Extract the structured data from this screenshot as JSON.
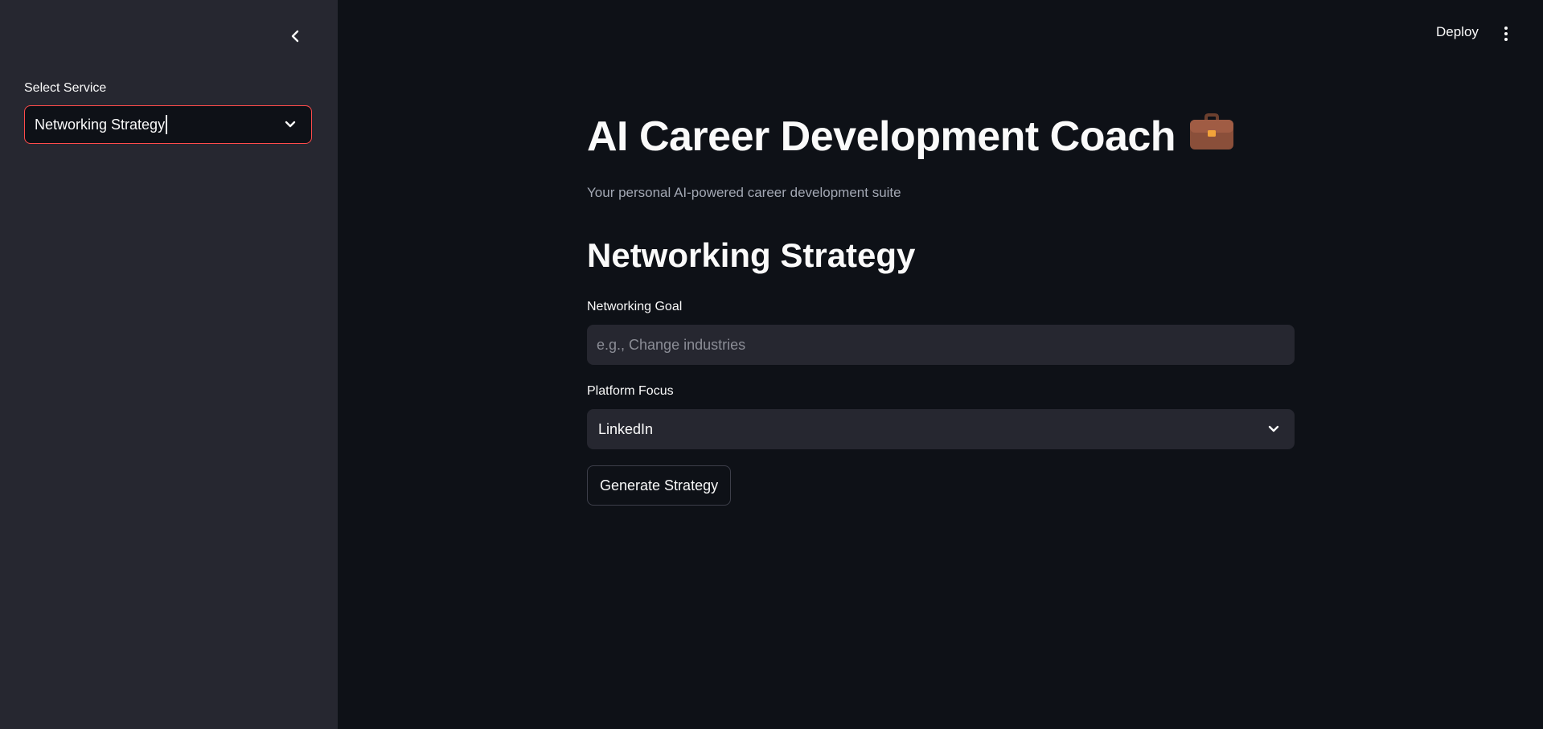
{
  "sidebar": {
    "select_label": "Select Service",
    "select_value": "Networking Strategy",
    "collapse_icon": "chevron-left-icon"
  },
  "header": {
    "deploy_label": "Deploy",
    "menu_icon": "more-vertical-icon"
  },
  "main": {
    "title": "AI Career Development Coach",
    "title_icon": "briefcase-icon",
    "subtitle": "Your personal AI-powered career development suite",
    "section_title": "Networking Strategy",
    "goal_label": "Networking Goal",
    "goal_placeholder": "e.g., Change industries",
    "goal_value": "",
    "platform_label": "Platform Focus",
    "platform_value": "LinkedIn",
    "button_label": "Generate Strategy"
  },
  "colors": {
    "background": "#0e1117",
    "sidebar": "#262730",
    "accent": "#ff4b4b",
    "muted_text": "#a3a8b4"
  }
}
